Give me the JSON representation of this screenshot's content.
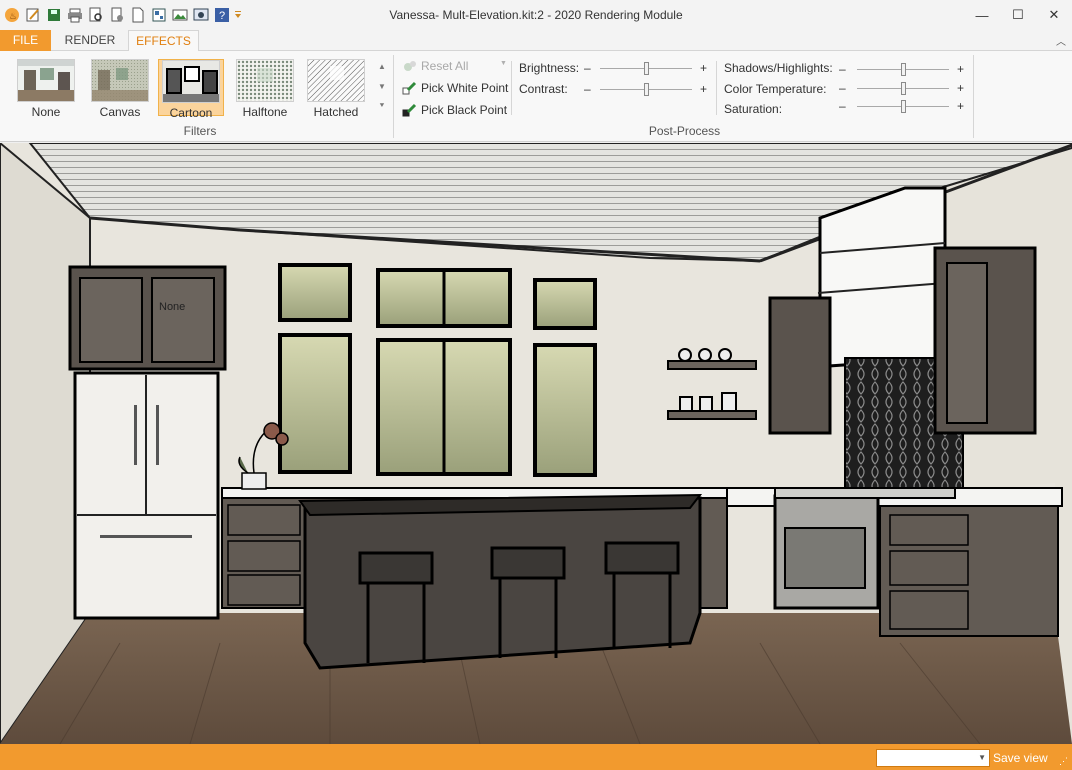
{
  "window": {
    "title": "Vanessa- Mult-Elevation.kit:2 - 2020 Rendering Module",
    "minimize": "—",
    "maximize": "☐",
    "close": "✕"
  },
  "quick_access": [
    "app-logo-icon",
    "edit-icon",
    "save-icon",
    "print-icon",
    "print-preview-icon",
    "document-settings-icon",
    "new-document-icon",
    "layout-icon",
    "image-icon",
    "screenshot-icon",
    "help-icon",
    "customize-dropdown-icon"
  ],
  "tabs": [
    {
      "label": "FILE"
    },
    {
      "label": "RENDER"
    },
    {
      "label": "EFFECTS"
    }
  ],
  "filters": {
    "group_label": "Filters",
    "items": [
      {
        "label": "None"
      },
      {
        "label": "Canvas"
      },
      {
        "label": "Cartoon"
      },
      {
        "label": "Halftone"
      },
      {
        "label": "Hatched"
      }
    ],
    "selected": "Cartoon"
  },
  "postprocess": {
    "group_label": "Post-Process",
    "reset_all": "Reset All",
    "pick_white": "Pick White Point",
    "pick_black": "Pick Black Point",
    "minus": "–",
    "plus": "+",
    "sliders": [
      {
        "label": "Brightness:",
        "value": 0.5
      },
      {
        "label": "Contrast:",
        "value": 0.5
      },
      {
        "label": "Shadows/Highlights:",
        "value": 0.5
      },
      {
        "label": "Color Temperature:",
        "value": 0.5
      },
      {
        "label": "Saturation:",
        "value": 0.5
      }
    ]
  },
  "viewport": {
    "overlay_label": "None"
  },
  "statusbar": {
    "view_select_value": "",
    "save_view": "Save view"
  },
  "colors": {
    "accent": "#f29a2e",
    "selected_fill": "#fbd49c"
  }
}
